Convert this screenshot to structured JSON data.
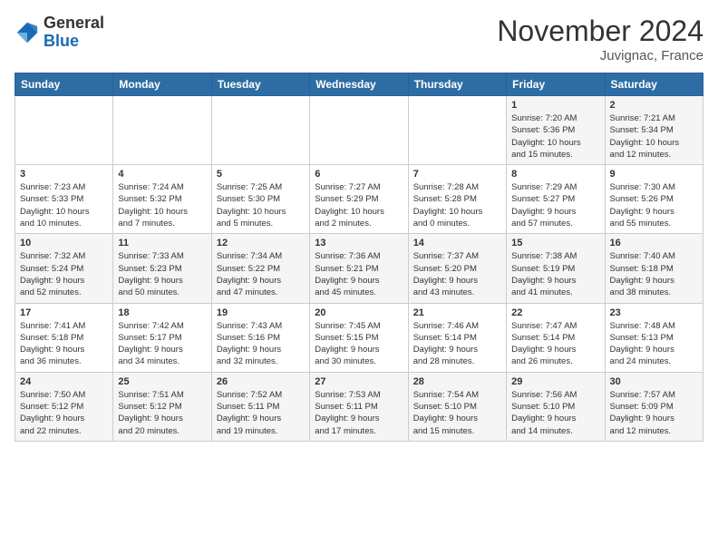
{
  "logo": {
    "text_general": "General",
    "text_blue": "Blue"
  },
  "title": "November 2024",
  "subtitle": "Juvignac, France",
  "days_of_week": [
    "Sunday",
    "Monday",
    "Tuesday",
    "Wednesday",
    "Thursday",
    "Friday",
    "Saturday"
  ],
  "weeks": [
    [
      {
        "day": "",
        "info": ""
      },
      {
        "day": "",
        "info": ""
      },
      {
        "day": "",
        "info": ""
      },
      {
        "day": "",
        "info": ""
      },
      {
        "day": "",
        "info": ""
      },
      {
        "day": "1",
        "info": "Sunrise: 7:20 AM\nSunset: 5:36 PM\nDaylight: 10 hours\nand 15 minutes."
      },
      {
        "day": "2",
        "info": "Sunrise: 7:21 AM\nSunset: 5:34 PM\nDaylight: 10 hours\nand 12 minutes."
      }
    ],
    [
      {
        "day": "3",
        "info": "Sunrise: 7:23 AM\nSunset: 5:33 PM\nDaylight: 10 hours\nand 10 minutes."
      },
      {
        "day": "4",
        "info": "Sunrise: 7:24 AM\nSunset: 5:32 PM\nDaylight: 10 hours\nand 7 minutes."
      },
      {
        "day": "5",
        "info": "Sunrise: 7:25 AM\nSunset: 5:30 PM\nDaylight: 10 hours\nand 5 minutes."
      },
      {
        "day": "6",
        "info": "Sunrise: 7:27 AM\nSunset: 5:29 PM\nDaylight: 10 hours\nand 2 minutes."
      },
      {
        "day": "7",
        "info": "Sunrise: 7:28 AM\nSunset: 5:28 PM\nDaylight: 10 hours\nand 0 minutes."
      },
      {
        "day": "8",
        "info": "Sunrise: 7:29 AM\nSunset: 5:27 PM\nDaylight: 9 hours\nand 57 minutes."
      },
      {
        "day": "9",
        "info": "Sunrise: 7:30 AM\nSunset: 5:26 PM\nDaylight: 9 hours\nand 55 minutes."
      }
    ],
    [
      {
        "day": "10",
        "info": "Sunrise: 7:32 AM\nSunset: 5:24 PM\nDaylight: 9 hours\nand 52 minutes."
      },
      {
        "day": "11",
        "info": "Sunrise: 7:33 AM\nSunset: 5:23 PM\nDaylight: 9 hours\nand 50 minutes."
      },
      {
        "day": "12",
        "info": "Sunrise: 7:34 AM\nSunset: 5:22 PM\nDaylight: 9 hours\nand 47 minutes."
      },
      {
        "day": "13",
        "info": "Sunrise: 7:36 AM\nSunset: 5:21 PM\nDaylight: 9 hours\nand 45 minutes."
      },
      {
        "day": "14",
        "info": "Sunrise: 7:37 AM\nSunset: 5:20 PM\nDaylight: 9 hours\nand 43 minutes."
      },
      {
        "day": "15",
        "info": "Sunrise: 7:38 AM\nSunset: 5:19 PM\nDaylight: 9 hours\nand 41 minutes."
      },
      {
        "day": "16",
        "info": "Sunrise: 7:40 AM\nSunset: 5:18 PM\nDaylight: 9 hours\nand 38 minutes."
      }
    ],
    [
      {
        "day": "17",
        "info": "Sunrise: 7:41 AM\nSunset: 5:18 PM\nDaylight: 9 hours\nand 36 minutes."
      },
      {
        "day": "18",
        "info": "Sunrise: 7:42 AM\nSunset: 5:17 PM\nDaylight: 9 hours\nand 34 minutes."
      },
      {
        "day": "19",
        "info": "Sunrise: 7:43 AM\nSunset: 5:16 PM\nDaylight: 9 hours\nand 32 minutes."
      },
      {
        "day": "20",
        "info": "Sunrise: 7:45 AM\nSunset: 5:15 PM\nDaylight: 9 hours\nand 30 minutes."
      },
      {
        "day": "21",
        "info": "Sunrise: 7:46 AM\nSunset: 5:14 PM\nDaylight: 9 hours\nand 28 minutes."
      },
      {
        "day": "22",
        "info": "Sunrise: 7:47 AM\nSunset: 5:14 PM\nDaylight: 9 hours\nand 26 minutes."
      },
      {
        "day": "23",
        "info": "Sunrise: 7:48 AM\nSunset: 5:13 PM\nDaylight: 9 hours\nand 24 minutes."
      }
    ],
    [
      {
        "day": "24",
        "info": "Sunrise: 7:50 AM\nSunset: 5:12 PM\nDaylight: 9 hours\nand 22 minutes."
      },
      {
        "day": "25",
        "info": "Sunrise: 7:51 AM\nSunset: 5:12 PM\nDaylight: 9 hours\nand 20 minutes."
      },
      {
        "day": "26",
        "info": "Sunrise: 7:52 AM\nSunset: 5:11 PM\nDaylight: 9 hours\nand 19 minutes."
      },
      {
        "day": "27",
        "info": "Sunrise: 7:53 AM\nSunset: 5:11 PM\nDaylight: 9 hours\nand 17 minutes."
      },
      {
        "day": "28",
        "info": "Sunrise: 7:54 AM\nSunset: 5:10 PM\nDaylight: 9 hours\nand 15 minutes."
      },
      {
        "day": "29",
        "info": "Sunrise: 7:56 AM\nSunset: 5:10 PM\nDaylight: 9 hours\nand 14 minutes."
      },
      {
        "day": "30",
        "info": "Sunrise: 7:57 AM\nSunset: 5:09 PM\nDaylight: 9 hours\nand 12 minutes."
      }
    ]
  ]
}
